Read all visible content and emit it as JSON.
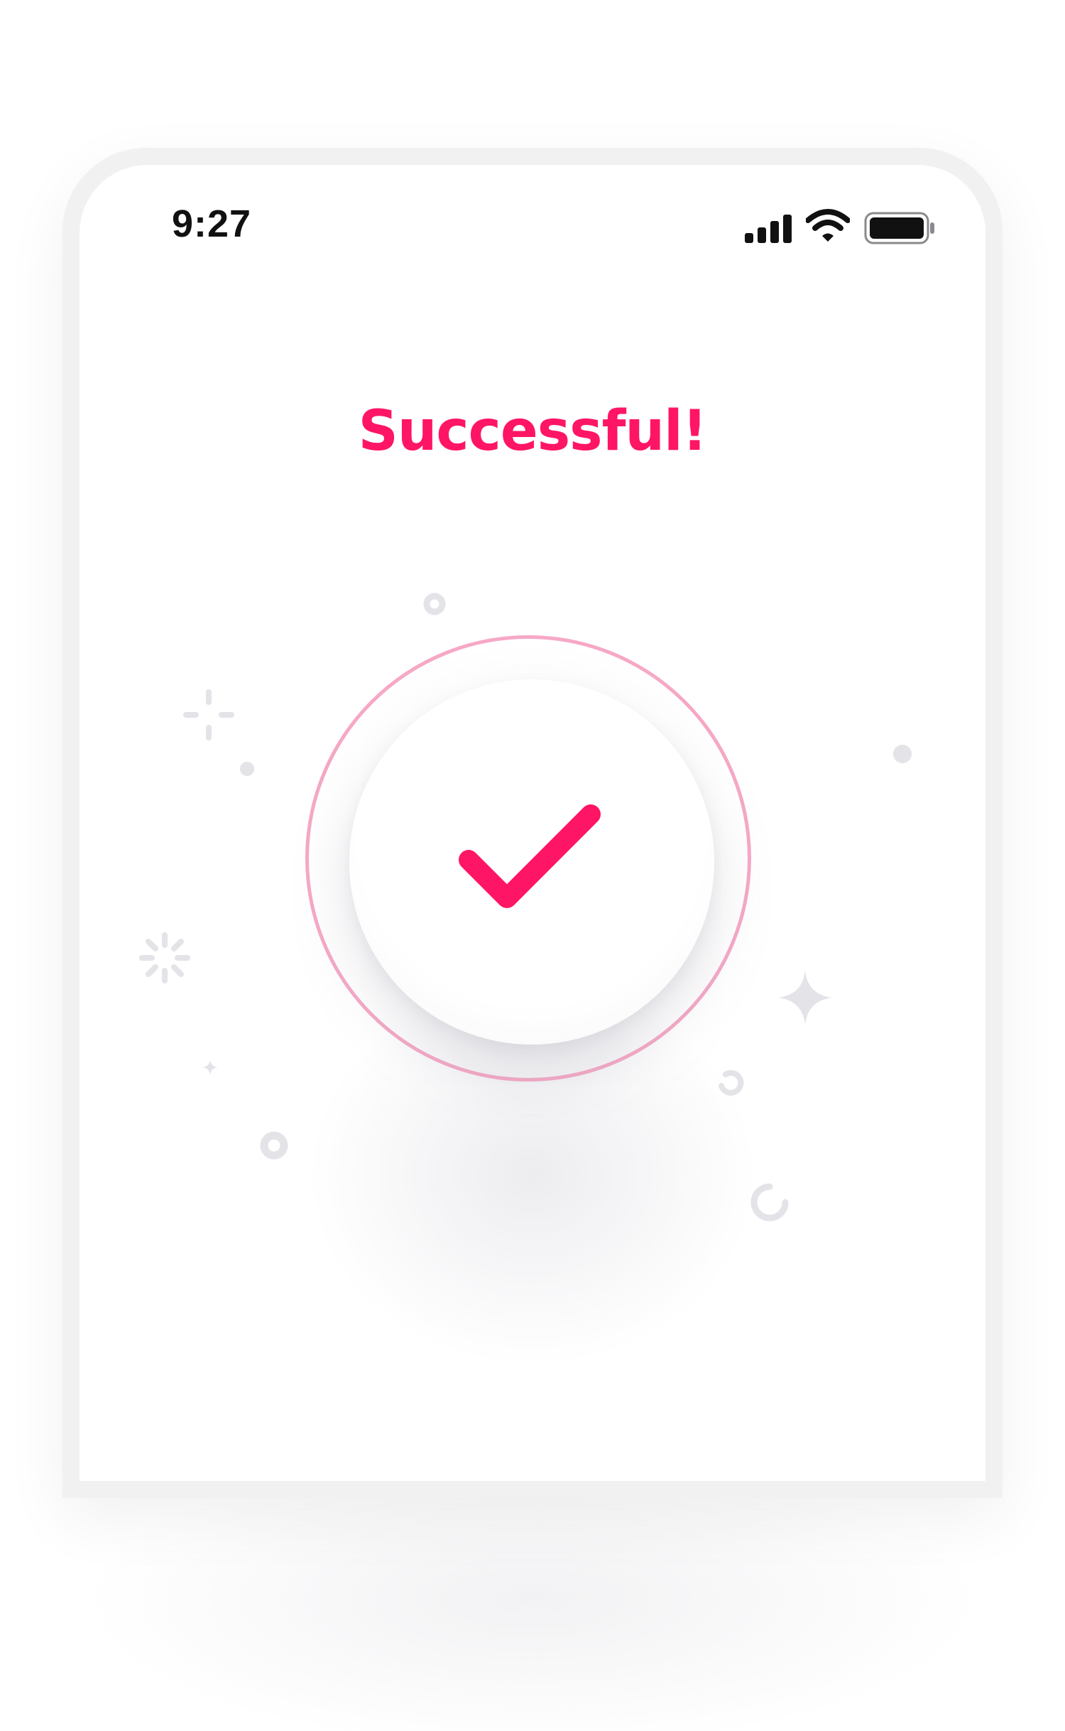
{
  "status_bar": {
    "time": "9:27",
    "icons": [
      "cellular-signal-icon",
      "wifi-icon",
      "battery-icon"
    ]
  },
  "screen": {
    "title": "Successful!"
  },
  "icons": {
    "success": "checkmark-icon",
    "decorations": [
      "dot-ring-icon",
      "sparkle-cross-icon",
      "dot-icon",
      "burst-icon",
      "star-icon",
      "small-star-icon",
      "ring-icon",
      "arc-icon"
    ]
  },
  "colors": {
    "accent": "#ff1565",
    "ring": "#f6a8c6",
    "decoration": "#e3e3e8",
    "status_text": "#111111"
  }
}
